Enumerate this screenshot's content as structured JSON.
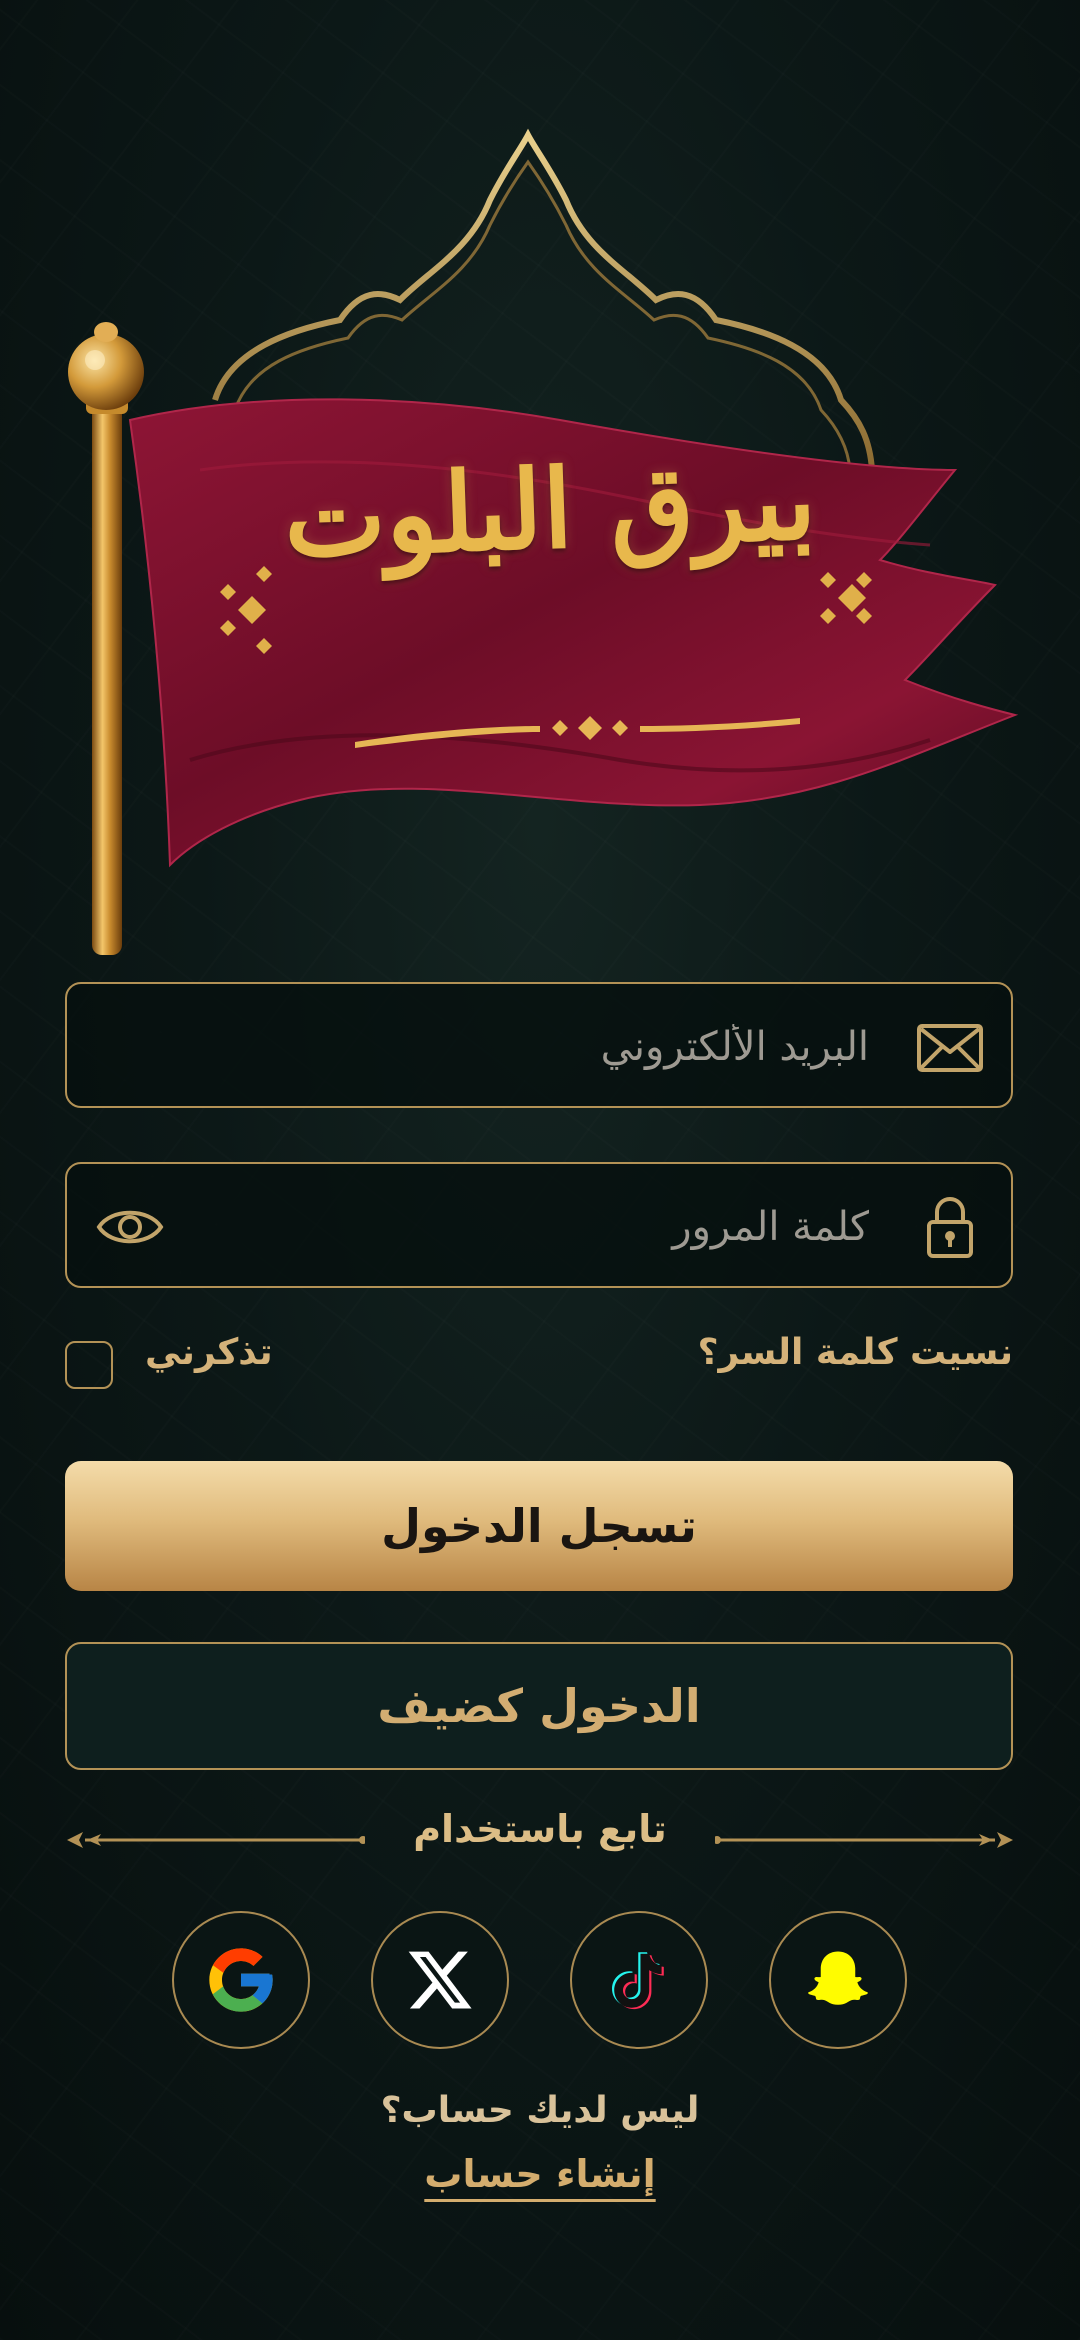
{
  "hero": {
    "title": "بيرق البلوت"
  },
  "form": {
    "email_placeholder": "البريد الألكتروني",
    "password_placeholder": "كلمة المرور",
    "forgot_password": "نسيت كلمة السر؟",
    "remember_me": "تذكرني",
    "remember_me_checked": false
  },
  "buttons": {
    "login": "تسجل الدخول",
    "guest": "الدخول كضيف"
  },
  "social": {
    "divider_label": "تابع باستخدام",
    "providers": [
      "google-icon",
      "x-icon",
      "tiktok-icon",
      "snapchat-icon"
    ]
  },
  "footer": {
    "no_account": "ليس لديك حساب؟",
    "create_account": "إنشاء حساب"
  },
  "colors": {
    "background": "#0c1817",
    "gold": "#b39256",
    "flag": "#7a0f2b",
    "button_gradient_top": "#f4dcaa",
    "button_gradient_bottom": "#b88546"
  }
}
